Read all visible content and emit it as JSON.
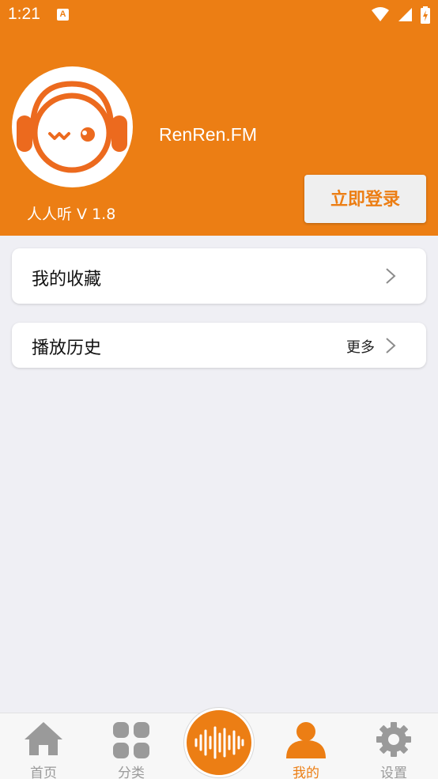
{
  "status_bar": {
    "time": "1:21",
    "app_icon_glyph": "A",
    "icons": [
      "wifi-icon",
      "signal-icon",
      "battery-charging-icon"
    ]
  },
  "header": {
    "brand_title": "RenRen.FM",
    "version": "人人听 V 1.8",
    "login_button": "立即登录",
    "avatar_icon": "headphone-mascot-logo",
    "background_color": "#ec7e14"
  },
  "cards": {
    "favorites": {
      "title": "我的收藏",
      "icon": "chevron-right-icon"
    },
    "history": {
      "title": "播放历史",
      "more": "更多",
      "icon": "chevron-right-icon"
    }
  },
  "bottom_nav": {
    "items": [
      {
        "label": "首页",
        "icon": "home-icon",
        "active": false
      },
      {
        "label": "分类",
        "icon": "category-grid-icon",
        "active": false
      },
      {
        "label": "我的",
        "icon": "user-icon",
        "active": true
      },
      {
        "label": "设置",
        "icon": "gear-icon",
        "active": false
      }
    ],
    "player_icon": "sound-wave-icon"
  },
  "colors": {
    "accent": "#ec7e14",
    "background": "#efeff4",
    "inactive": "#9a9a9a"
  }
}
